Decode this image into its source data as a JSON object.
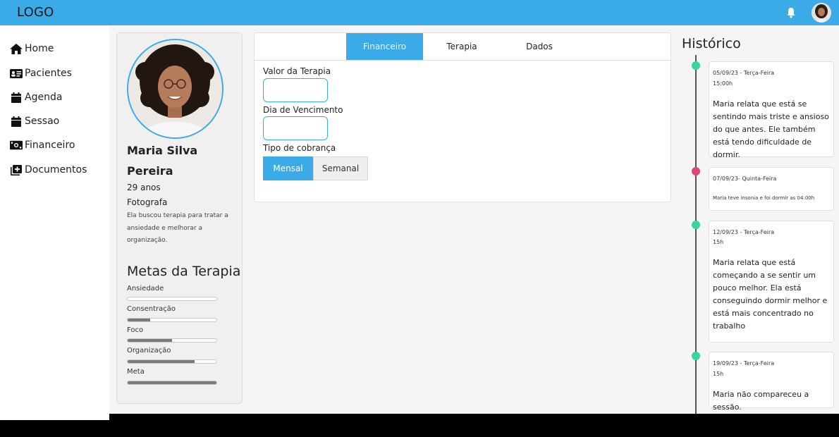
{
  "app": {
    "logo": "LOGO"
  },
  "colors": {
    "accent": "#3aabe6",
    "dot_green": "#33d99a",
    "dot_pink": "#e0457b"
  },
  "header": {
    "icons": [
      "bell-icon",
      "user-avatar"
    ]
  },
  "sidebar": {
    "items": [
      {
        "label": "Home",
        "icon": "home-icon"
      },
      {
        "label": "Pacientes",
        "icon": "id-card-icon"
      },
      {
        "label": "Agenda",
        "icon": "calendar-icon"
      },
      {
        "label": "Sessao",
        "icon": "calendar-icon"
      },
      {
        "label": "Financeiro",
        "icon": "money-icon"
      },
      {
        "label": "Documentos",
        "icon": "documents-icon"
      }
    ]
  },
  "profile": {
    "name_line1": "Maria Silva",
    "name_line2": "Pereira",
    "age": "29 anos",
    "occupation": "Fotografa",
    "description": "Ela buscou terapia para tratar a ansiedade e melhorar a organização.",
    "goals_title": "Metas da Terapia",
    "goals": [
      {
        "label": "Ansiedade",
        "progress": 0.0
      },
      {
        "label": "Consentração",
        "progress": 0.25
      },
      {
        "label": "Foco",
        "progress": 0.5
      },
      {
        "label": "Organização",
        "progress": 0.75
      },
      {
        "label": "Meta",
        "progress": 1.0
      }
    ]
  },
  "form": {
    "tabs": [
      {
        "label": "Financeiro",
        "active": true
      },
      {
        "label": "Terapia",
        "active": false
      },
      {
        "label": "Dados",
        "active": false
      }
    ],
    "valor_label": "Valor da Terapia",
    "valor_value": "",
    "vencimento_label": "Dia de Vencimento",
    "vencimento_value": "",
    "cobranca_label": "Tipo de cobrança",
    "cobranca_options": [
      "Mensal",
      "Semanal"
    ],
    "cobranca_selected": "Mensal"
  },
  "history": {
    "title": "Histórico",
    "entries": [
      {
        "date": "05/09/23 - Terça-Feira",
        "time": "15:00h",
        "text": "Maria relata que está se sentindo mais triste e ansioso do que antes. Ele também está tendo dificuldade de dormir.",
        "dot": "green"
      },
      {
        "date": "07/09/23- Quinta-Feira",
        "time": "",
        "text": "Maria teve insonia e foi dormir as 04:00h",
        "dot": "pink"
      },
      {
        "date": "12/09/23 - Terça-Feira",
        "time": "15h",
        "text": "Maria relata que está começando a se sentir um pouco melhor. Ela está conseguindo dormir melhor e está mais concentrado no trabalho",
        "dot": "green"
      },
      {
        "date": "19/09/23 - Terça-Feira",
        "time": "15h",
        "text": "Maria não compareceu a sessão.",
        "dot": "green"
      }
    ]
  }
}
